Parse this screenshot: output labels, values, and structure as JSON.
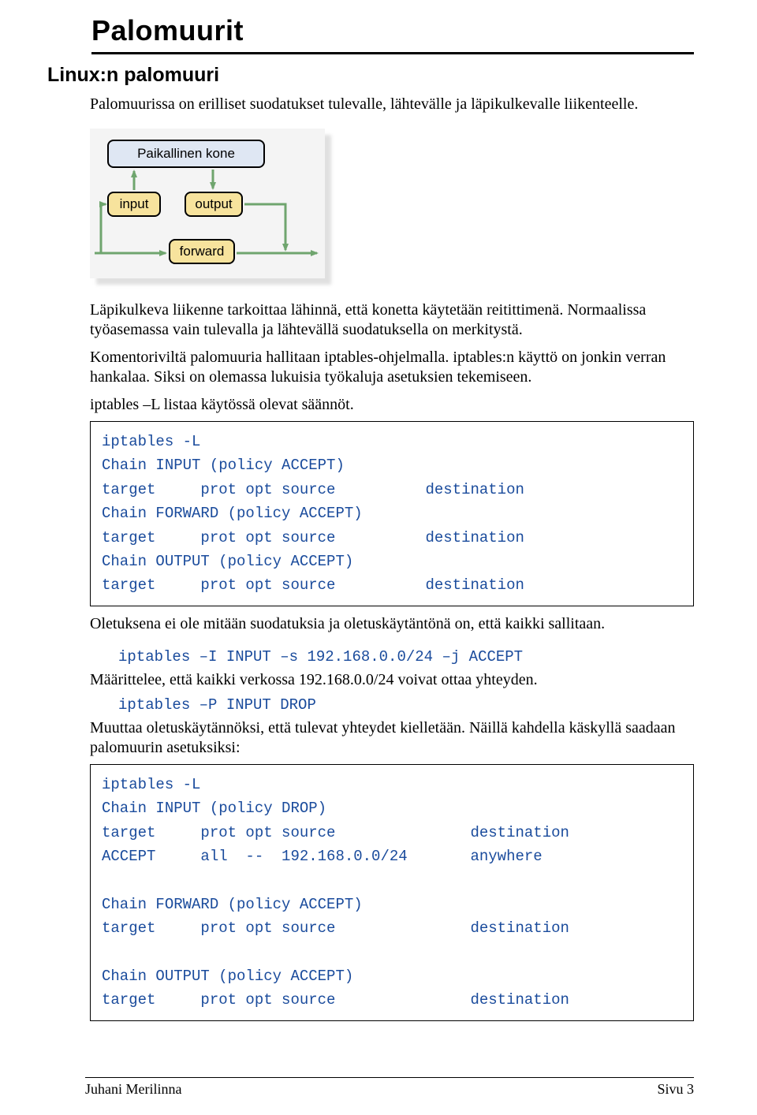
{
  "header": {
    "title": "Palomuurit"
  },
  "section": {
    "heading": "Linux:n palomuuri",
    "intro": "Palomuurissa on erilliset suodatukset tulevalle, lähtevälle ja läpikulkevalle liikenteelle."
  },
  "diagram": {
    "local": "Paikallinen kone",
    "input": "input",
    "output": "output",
    "forward": "forward"
  },
  "para2": "Läpikulkeva liikenne tarkoittaa lähinnä, että konetta käytetään reitittimenä. Normaalissa työasemassa vain tulevalla ja lähtevällä suodatuksella on merkitystä.",
  "para3": "Komentoriviltä palomuuria hallitaan iptables-ohjelmalla. iptables:n käyttö on jonkin verran hankalaa. Siksi on olemassa lukuisia työkaluja asetuksien tekemiseen.",
  "para4": "iptables –L listaa käytössä olevat säännöt.",
  "code1": "iptables -L\nChain INPUT (policy ACCEPT)\ntarget     prot opt source          destination\nChain FORWARD (policy ACCEPT)\ntarget     prot opt source          destination\nChain OUTPUT (policy ACCEPT)\ntarget     prot opt source          destination",
  "para5": "Oletuksena ei ole mitään suodatuksia ja oletuskäytäntönä on, että kaikki sallitaan.",
  "cmd1": "iptables –I INPUT –s 192.168.0.0/24 –j ACCEPT",
  "para6": "Määrittelee, että kaikki verkossa 192.168.0.0/24 voivat ottaa yhteyden.",
  "cmd2": "iptables –P INPUT DROP",
  "para7": "Muuttaa oletuskäytännöksi, että tulevat yhteydet kielletään. Näillä kahdella käskyllä saadaan palomuurin asetuksiksi:",
  "code2": "iptables -L\nChain INPUT (policy DROP)\ntarget     prot opt source               destination\nACCEPT     all  --  192.168.0.0/24       anywhere\n\nChain FORWARD (policy ACCEPT)\ntarget     prot opt source               destination\n\nChain OUTPUT (policy ACCEPT)\ntarget     prot opt source               destination",
  "footer": {
    "author": "Juhani Merilinna",
    "page": "Sivu 3"
  }
}
